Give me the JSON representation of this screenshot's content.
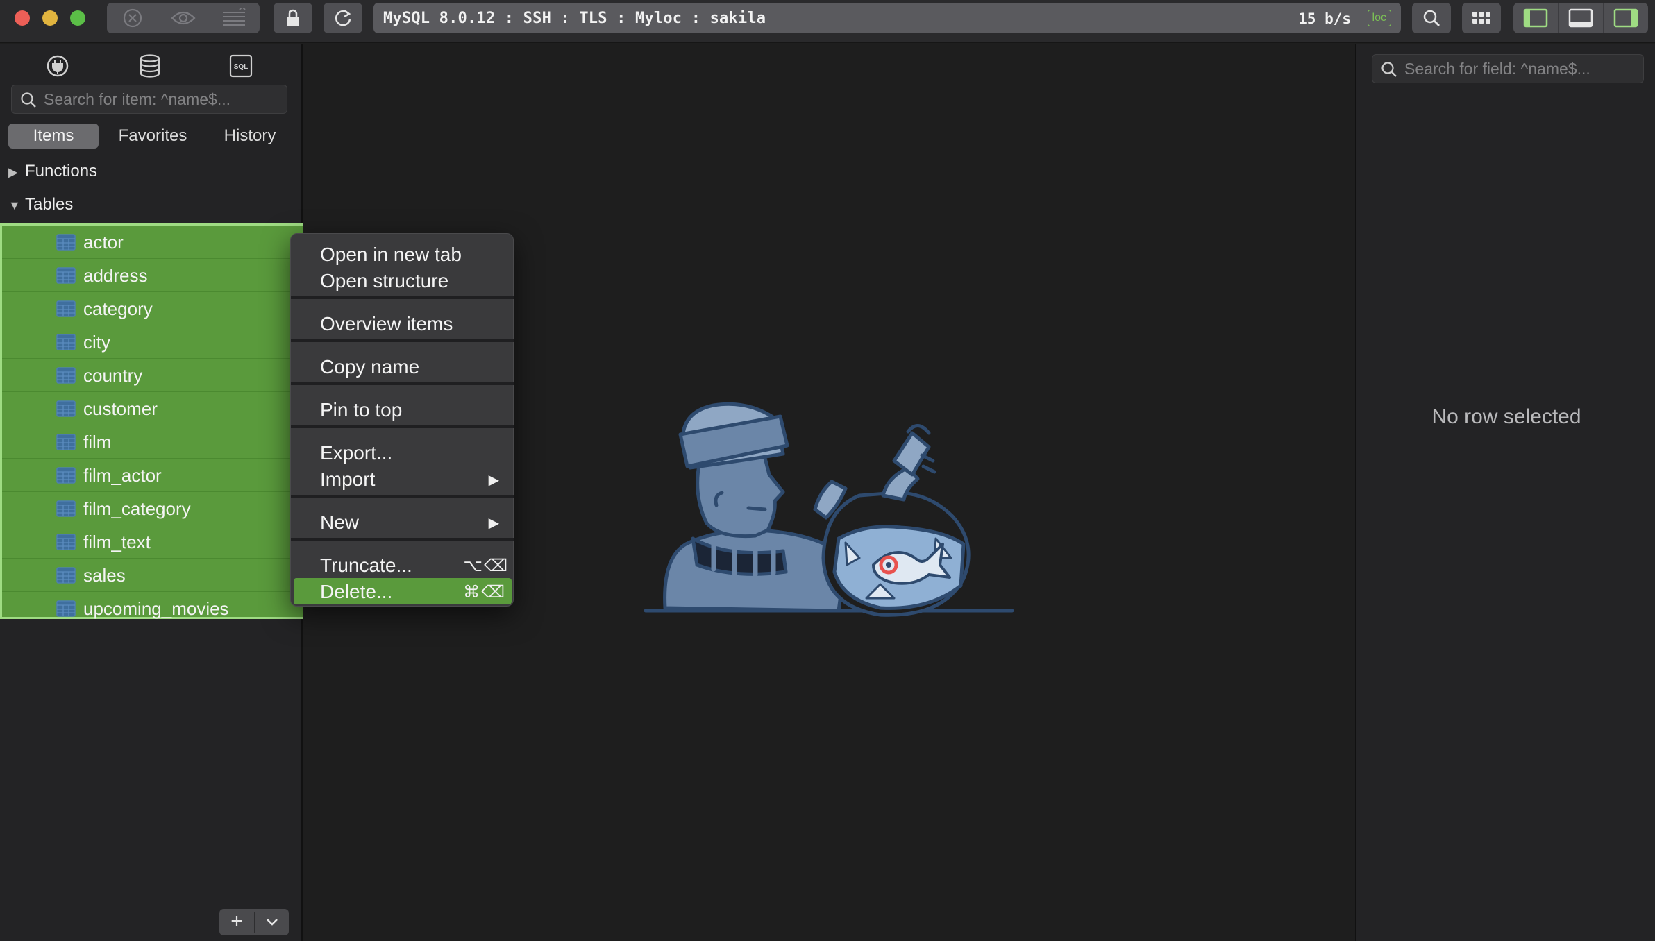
{
  "window": {
    "connection_title": "MySQL 8.0.12 : SSH : TLS : Myloc : sakila",
    "transfer_rate": "15 b/s",
    "env_badge": "loc"
  },
  "toolbar": {
    "icons": [
      "close-connection-icon",
      "preview-icon",
      "console-icon",
      "lock-icon",
      "refresh-icon",
      "search-icon",
      "grid-icon",
      "toggle-left-panel-icon",
      "toggle-bottom-panel-icon",
      "toggle-right-panel-icon"
    ]
  },
  "sidebar": {
    "icons": [
      "connection-plug-icon",
      "database-icon",
      "sql-query-icon"
    ],
    "sql_icon_text": "SQL",
    "search_placeholder": "Search for item: ^name$...",
    "tabs": [
      {
        "label": "Items",
        "active": true
      },
      {
        "label": "Favorites",
        "active": false
      },
      {
        "label": "History",
        "active": false
      }
    ],
    "groups": [
      {
        "label": "Functions",
        "expanded": false
      },
      {
        "label": "Tables",
        "expanded": true
      }
    ],
    "tables": [
      "actor",
      "address",
      "category",
      "city",
      "country",
      "customer",
      "film",
      "film_actor",
      "film_category",
      "film_text",
      "sales",
      "upcoming_movies"
    ],
    "add_label": "+",
    "more_label": "⌄"
  },
  "context_menu": {
    "items": [
      {
        "label": "Open in new tab"
      },
      {
        "label": "Open structure"
      },
      {
        "label": "Overview items"
      },
      {
        "label": "Copy name"
      },
      {
        "label": "Pin to top"
      },
      {
        "label": "Export..."
      },
      {
        "label": "Import",
        "submenu": "▶"
      },
      {
        "label": "New",
        "submenu": "▶"
      },
      {
        "label": "Truncate...",
        "shortcut": "⌥⌫"
      },
      {
        "label": "Delete...",
        "shortcut": "⌘⌫",
        "highlighted": true
      }
    ]
  },
  "right_panel": {
    "search_placeholder": "Search for field: ^name$...",
    "empty_text": "No row selected"
  },
  "colors": {
    "selection_green": "#5a9a3c",
    "accent_green": "#7bbf55",
    "illustration_blue": "#2e4a6e"
  }
}
